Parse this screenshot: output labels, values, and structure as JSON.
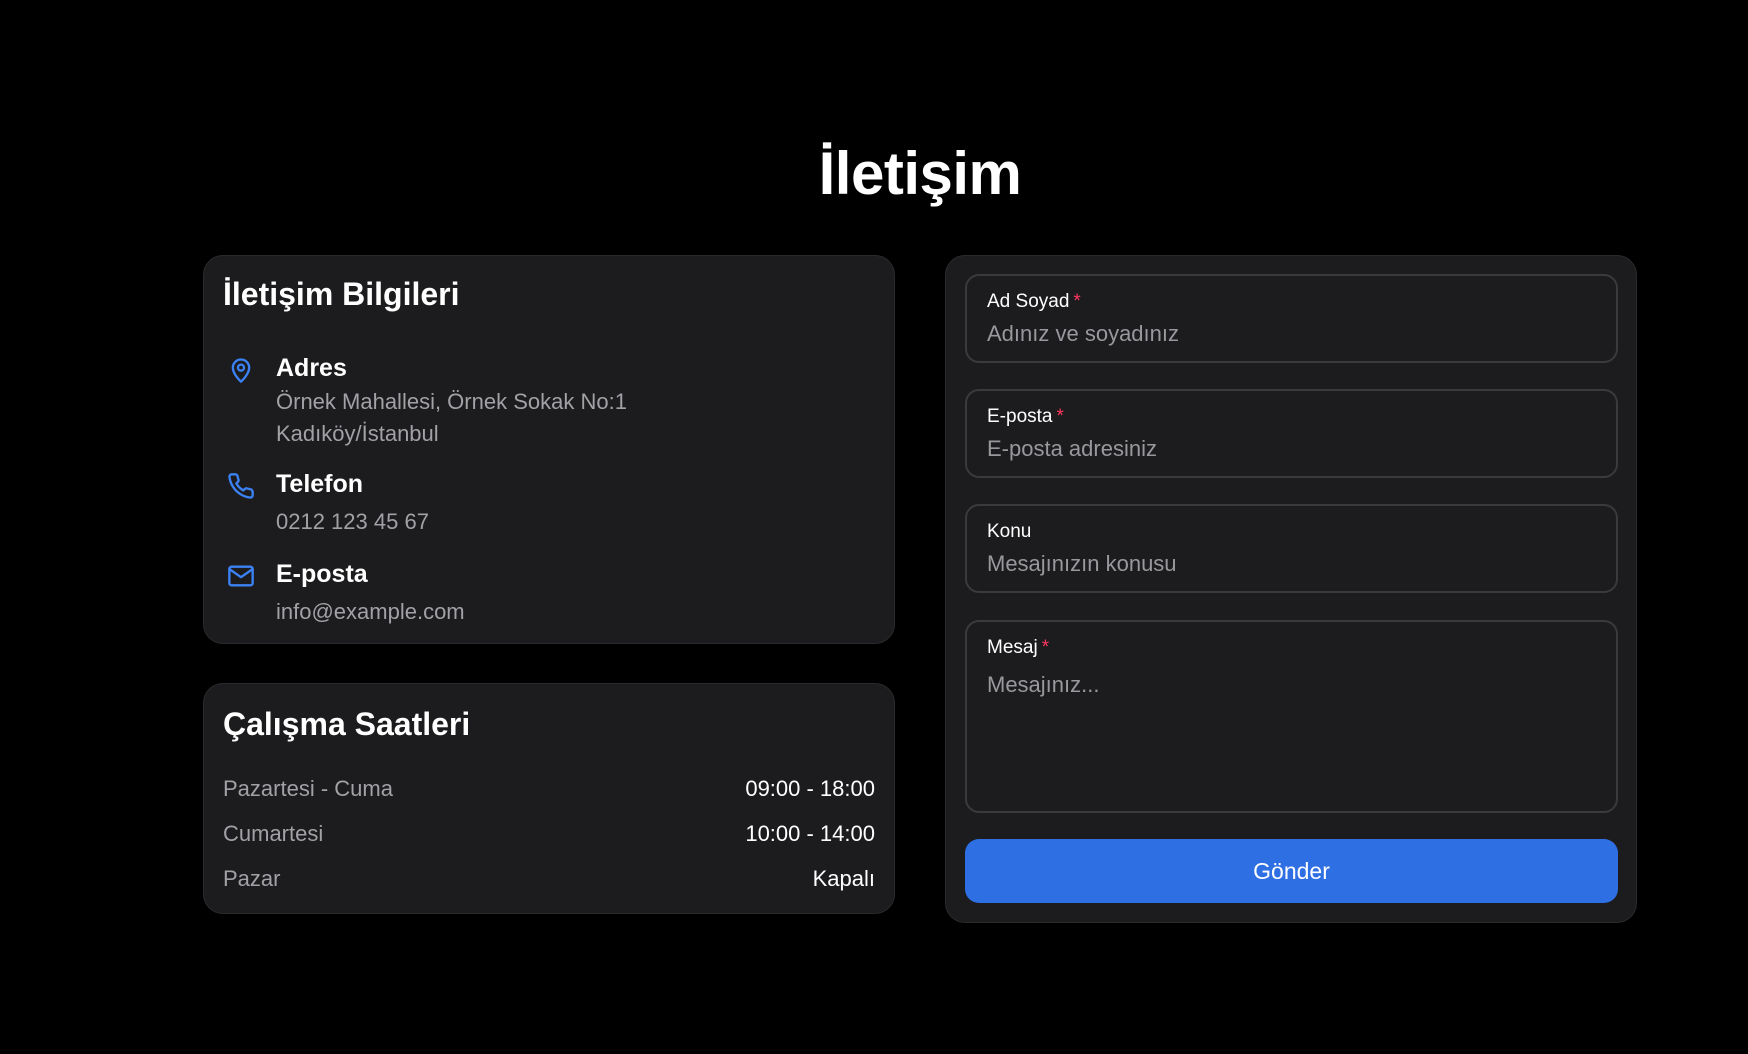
{
  "page": {
    "title": "İletişim"
  },
  "contact_info": {
    "title": "İletişim Bilgileri",
    "address": {
      "label": "Adres",
      "line1": "Örnek Mahallesi, Örnek Sokak No:1",
      "line2": "Kadıköy/İstanbul",
      "icon": "map-pin-icon"
    },
    "phone": {
      "label": "Telefon",
      "value": "0212 123 45 67",
      "icon": "phone-icon"
    },
    "email": {
      "label": "E-posta",
      "value": "info@example.com",
      "icon": "mail-icon"
    }
  },
  "hours": {
    "title": "Çalışma Saatleri",
    "rows": [
      {
        "day": "Pazartesi - Cuma",
        "time": "09:00 - 18:00"
      },
      {
        "day": "Cumartesi",
        "time": "10:00 - 14:00"
      },
      {
        "day": "Pazar",
        "time": "Kapalı"
      }
    ]
  },
  "form": {
    "name": {
      "label": "Ad Soyad",
      "required_mark": "*",
      "placeholder": "Adınız ve soyadınız",
      "value": ""
    },
    "email": {
      "label": "E-posta",
      "required_mark": "*",
      "placeholder": "E-posta adresiniz",
      "value": ""
    },
    "subject": {
      "label": "Konu",
      "placeholder": "Mesajınızın konusu",
      "value": ""
    },
    "message": {
      "label": "Mesaj",
      "required_mark": "*",
      "placeholder": "Mesajınız...",
      "value": ""
    },
    "submit_label": "Gönder"
  },
  "colors": {
    "accent": "#2f6fe4",
    "icon": "#3b82f6",
    "required": "#ff375f",
    "card_bg": "#1c1c1e",
    "page_bg": "#000000"
  }
}
